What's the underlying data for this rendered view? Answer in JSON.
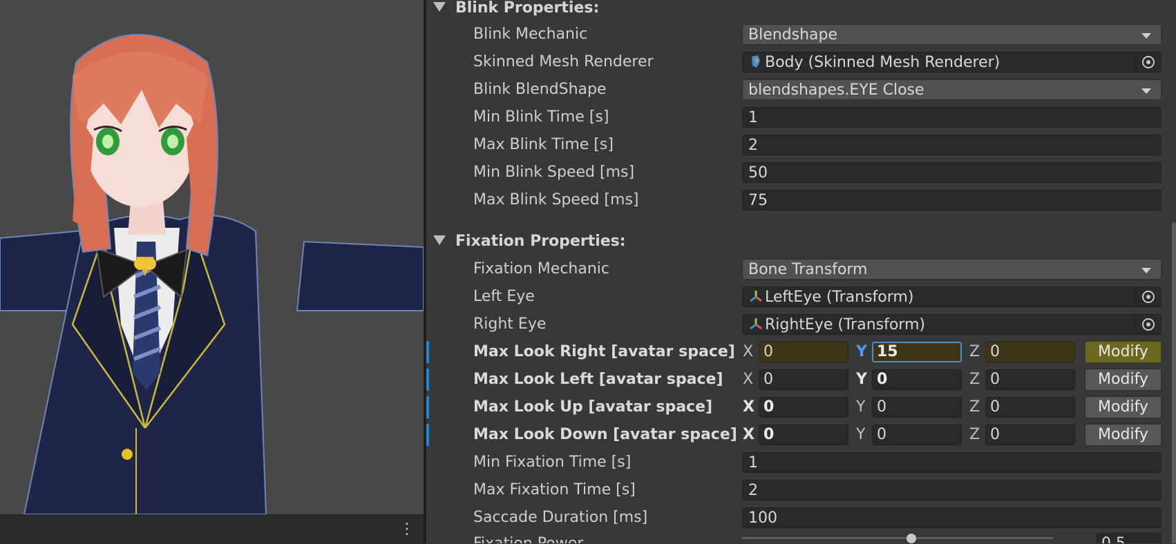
{
  "blink": {
    "title": "Blink Properties:",
    "mechanic_label": "Blink Mechanic",
    "mechanic_value": "Blendshape",
    "renderer_label": "Skinned Mesh Renderer",
    "renderer_value": "Body (Skinned Mesh Renderer)",
    "blendshape_label": "Blink BlendShape",
    "blendshape_value": "blendshapes.EYE Close",
    "min_time_label": "Min Blink Time [s]",
    "min_time_value": "1",
    "max_time_label": "Max Blink Time [s]",
    "max_time_value": "2",
    "min_speed_label": "Min Blink Speed [ms]",
    "min_speed_value": "50",
    "max_speed_label": "Max Blink Speed [ms]",
    "max_speed_value": "75"
  },
  "fixation": {
    "title": "Fixation Properties:",
    "mechanic_label": "Fixation Mechanic",
    "mechanic_value": "Bone Transform",
    "left_eye_label": "Left Eye",
    "left_eye_value": "LeftEye (Transform)",
    "right_eye_label": "Right Eye",
    "right_eye_value": "RightEye (Transform)",
    "look_right": {
      "label": "Max Look Right [avatar space]",
      "x_axis": "X",
      "y_axis": "Y",
      "z_axis": "Z",
      "x": "0",
      "y": "15",
      "z": "0",
      "button": "Modify"
    },
    "look_left": {
      "label": "Max Look Left [avatar space]",
      "x_axis": "X",
      "y_axis": "Y",
      "z_axis": "Z",
      "x": "0",
      "y": "0",
      "z": "0",
      "button": "Modify"
    },
    "look_up": {
      "label": "Max Look Up [avatar space]",
      "x_axis": "X",
      "y_axis": "Y",
      "z_axis": "Z",
      "x": "0",
      "y": "0",
      "z": "0",
      "button": "Modify"
    },
    "look_down": {
      "label": "Max Look Down [avatar space]",
      "x_axis": "X",
      "y_axis": "Y",
      "z_axis": "Z",
      "x": "0",
      "y": "0",
      "z": "0",
      "button": "Modify"
    },
    "min_time_label": "Min Fixation Time [s]",
    "min_time_value": "1",
    "max_time_label": "Max Fixation Time [s]",
    "max_time_value": "2",
    "saccade_label": "Saccade Duration [ms]",
    "saccade_value": "100",
    "power_label": "Fixation Power",
    "power_value": "0.5"
  },
  "colors": {
    "accent": "#1d85d6",
    "modified": "#6d6820",
    "scene_bg": "#484848"
  },
  "icons": {
    "scene_menu": "kebab-menu-icon",
    "mesh": "skinned-mesh-icon",
    "transform": "transform-icon",
    "picker": "object-picker-icon"
  }
}
